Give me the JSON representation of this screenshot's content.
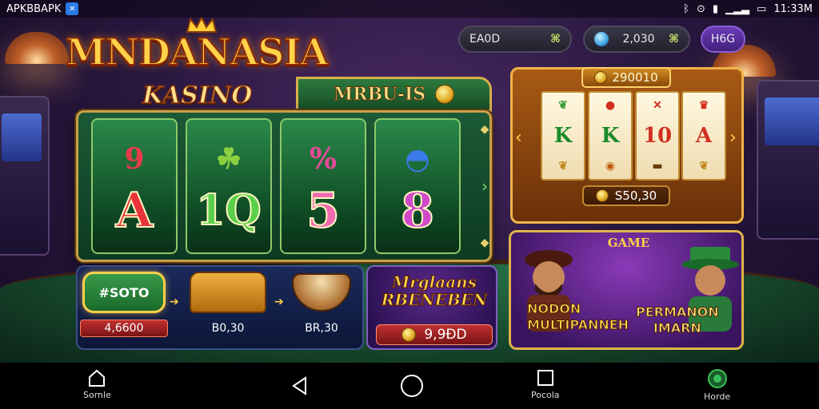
{
  "status_bar": {
    "app_label": "APKBBAPK",
    "time": "11:33M"
  },
  "logo": {
    "title": "MNDANASIA",
    "subtitle": "KASINO"
  },
  "top_pills": {
    "balance_1": "EA0D",
    "balance_2": "2,030",
    "button_label": "H6G"
  },
  "menu_tab": {
    "label": "MRBU-IS"
  },
  "reels": [
    {
      "top": "9",
      "main": "A",
      "top_color": "#e83a4a",
      "main_color": "#e8333a"
    },
    {
      "top": "☘",
      "main": "1Q",
      "top_color": "#8ad040",
      "main_color": "#5ad04a"
    },
    {
      "top": "%",
      "main": "5",
      "top_color": "#e84a9a",
      "main_color": "#f06ab0"
    },
    {
      "top": "◓",
      "main": "8",
      "top_color": "#3a7ae8",
      "main_color": "#d04ac8"
    }
  ],
  "bonus": {
    "slot_label": "#SOTO",
    "slot_value": "4,6600",
    "chest_value": "B0,30",
    "bowl_value": "BR,30"
  },
  "promo": {
    "title_line1": "Mrglaans",
    "title_line2": "RBENEBEN",
    "value": "9,9ÐD"
  },
  "right_reels": {
    "top_value": "290010",
    "bottom_value": "S50,30",
    "columns": [
      {
        "main": "K",
        "color": "#1a8a2a"
      },
      {
        "main": "K",
        "color": "#1a8a2a"
      },
      {
        "main": "10",
        "color": "#d03020"
      },
      {
        "main": "A",
        "color": "#d03020"
      }
    ]
  },
  "multi": {
    "banner": "GAME",
    "left_line1": "NODON",
    "left_line2": "MULTIPANNEH",
    "right_line1": "PERMANON",
    "right_line2": "IMARN"
  },
  "nav": {
    "left_label": "Sornle",
    "mid_label": "Pocola",
    "right_label": "Horde"
  }
}
